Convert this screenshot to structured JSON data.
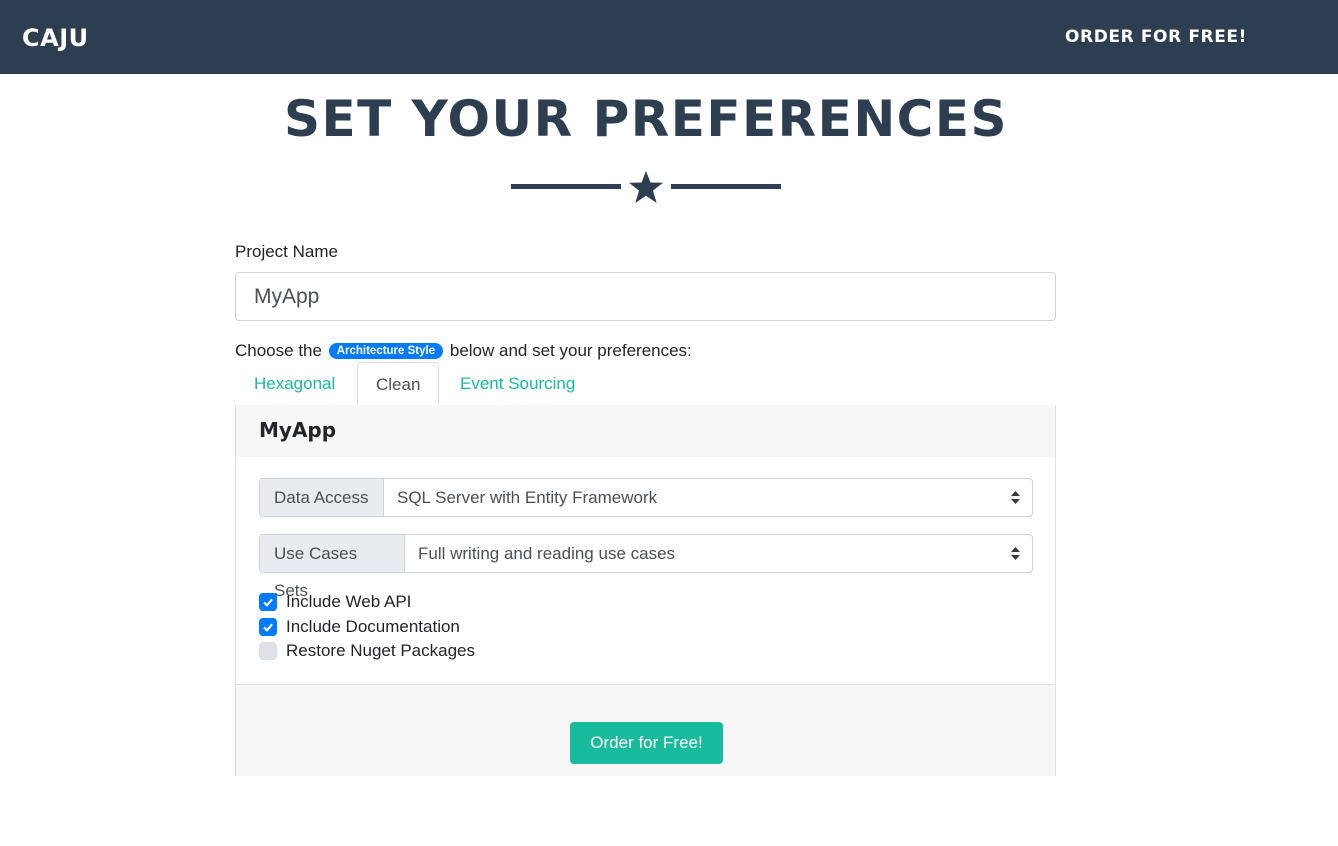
{
  "navbar": {
    "brand": "CAJU",
    "order_link": "ORDER FOR FREE!"
  },
  "header": {
    "title": "SET YOUR PREFERENCES",
    "divider_icon": "star-icon"
  },
  "form": {
    "project_name_label": "Project Name",
    "project_name_value": "MyApp",
    "choose_prefix": "Choose the",
    "architecture_badge": "Architecture Style",
    "choose_suffix": "below and set your preferences:"
  },
  "tabs": [
    {
      "label": "Hexagonal",
      "active": false
    },
    {
      "label": "Clean",
      "active": true
    },
    {
      "label": "Event Sourcing",
      "active": false
    }
  ],
  "card": {
    "title": "MyApp",
    "data_access_label": "Data Access",
    "data_access_value": "SQL Server with Entity Framework",
    "use_cases_label": "Use Cases Sets",
    "use_cases_value": "Full writing and reading use cases",
    "checkboxes": [
      {
        "label": "Include Web API",
        "checked": true
      },
      {
        "label": "Include Documentation",
        "checked": true
      },
      {
        "label": "Restore Nuget Packages",
        "checked": false
      }
    ],
    "order_button": "Order for Free!"
  },
  "colors": {
    "navbar": "#2c3e50",
    "accent": "#18bc9c",
    "badge": "#007bff"
  }
}
